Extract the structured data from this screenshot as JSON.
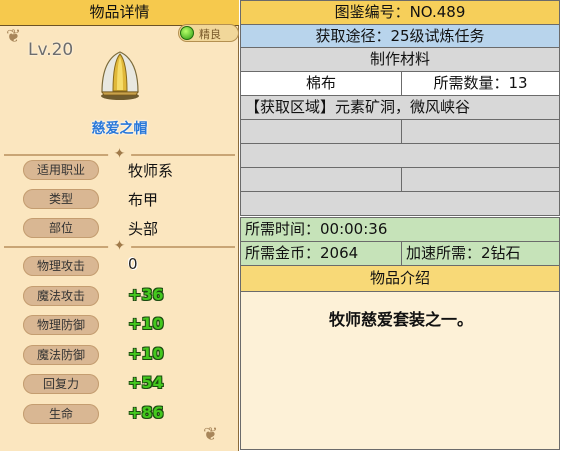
{
  "left": {
    "title": "物品详情",
    "rarity": "精良",
    "level": "Lv.20",
    "item_name": "慈爱之帽",
    "info": [
      {
        "label": "适用职业",
        "value": "牧师系"
      },
      {
        "label": "类型",
        "value": "布甲"
      },
      {
        "label": "部位",
        "value": "头部"
      }
    ],
    "stats": [
      {
        "label": "物理攻击",
        "value": "0"
      },
      {
        "label": "魔法攻击",
        "value": "+36"
      },
      {
        "label": "物理防御",
        "value": "+10"
      },
      {
        "label": "魔法防御",
        "value": "+10"
      },
      {
        "label": "回复力",
        "value": "+54"
      },
      {
        "label": "生命",
        "value": "+86"
      }
    ]
  },
  "right": {
    "codex": "图鉴编号：NO.489",
    "obtain": "获取途径：25级试炼任务",
    "materials_header": "制作材料",
    "material_name": "棉布",
    "material_qty": "所需数量：13",
    "area": "【获取区域】元素矿洞，微风峡谷",
    "time": "所需时间：00:00:36",
    "gold": "所需金币：2064",
    "speedup": "加速所需：2钻石",
    "intro_header": "物品介绍",
    "intro_text": "牧师慈爱套装之一。"
  },
  "colors": {
    "header_yellow": "#f6cf5a",
    "row_blue": "#b8d4ec",
    "row_gray": "#d8d8d8",
    "row_green": "#c6e3b9",
    "item_name_blue": "#2a78d8",
    "stat_green": "#44c81e"
  }
}
